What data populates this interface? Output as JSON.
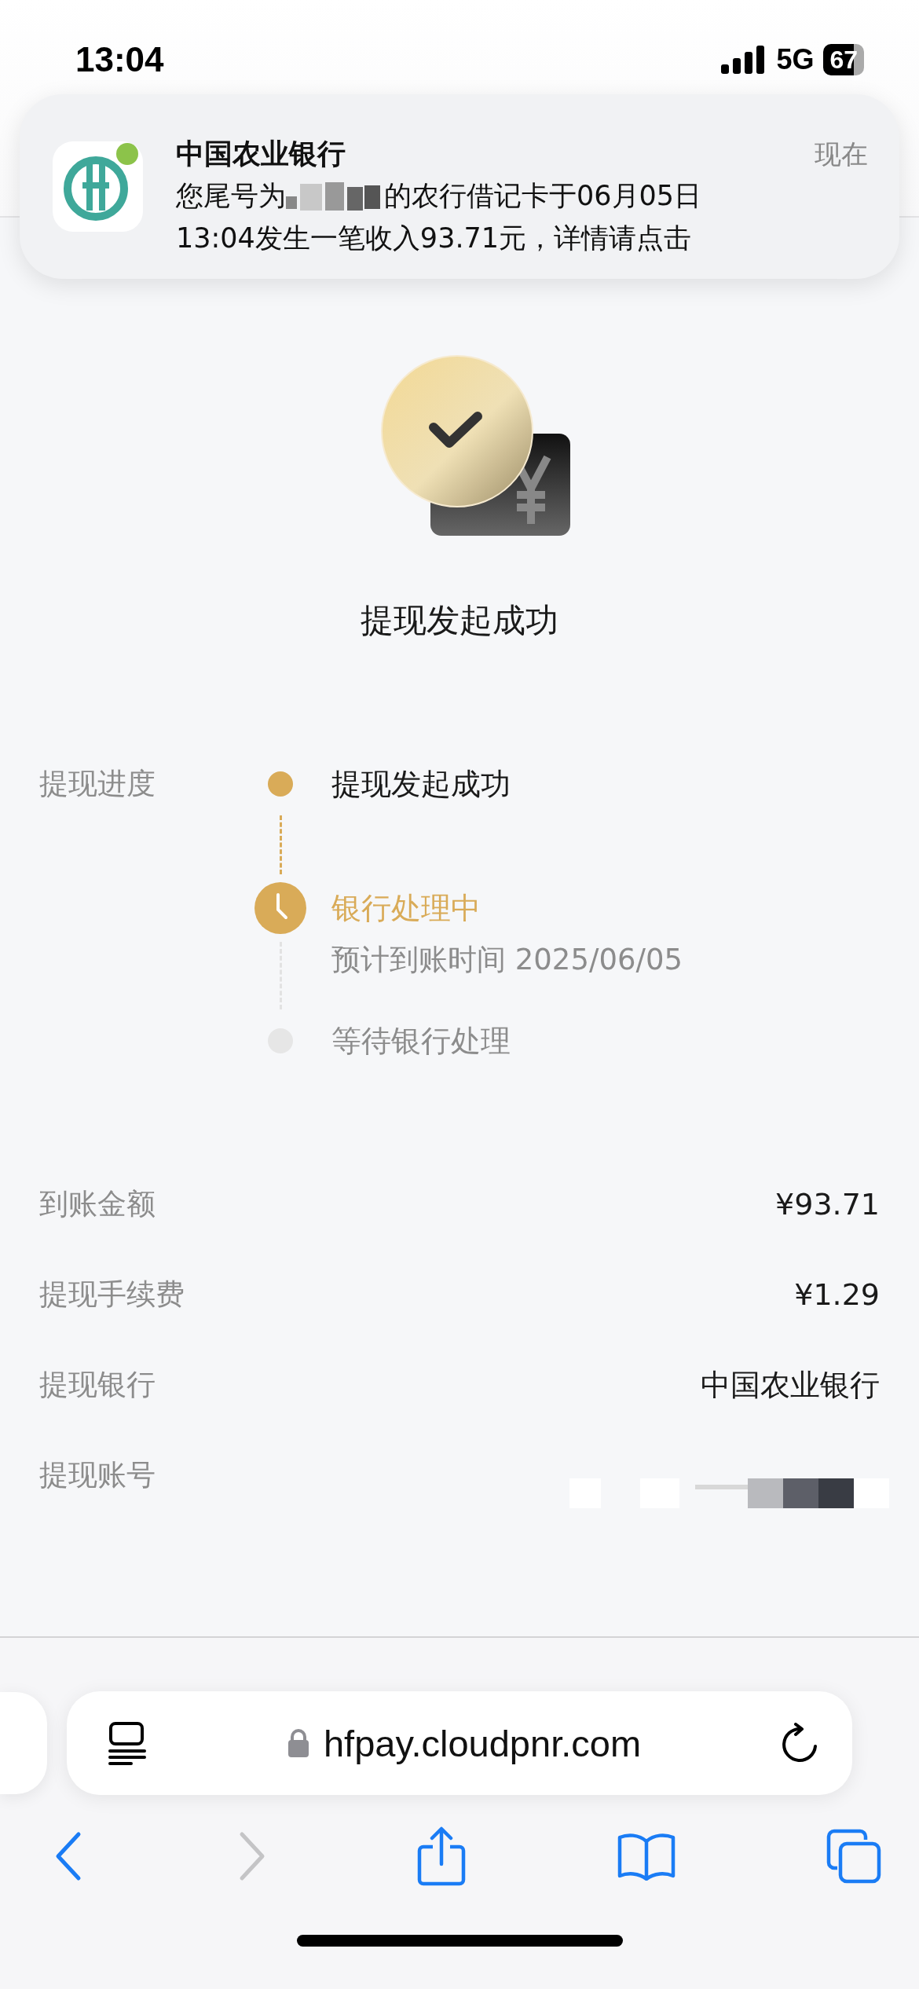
{
  "status_bar": {
    "time": "13:04",
    "network": "5G",
    "battery": "67"
  },
  "notification": {
    "app": "中国农业银行",
    "time": "现在",
    "line1_start": "您尾号为",
    "line1_end": "的农行借记卡于06月05日",
    "line2": "13:04发生一笔收入93.71元，详情请点击"
  },
  "hero": {
    "title": "提现发起成功"
  },
  "progress": {
    "label": "提现进度",
    "steps": [
      {
        "kind": "done",
        "title": "提现发起成功"
      },
      {
        "kind": "current",
        "title": "银行处理中",
        "subtitle": "预计到账时间 2025/06/05"
      },
      {
        "kind": "pending",
        "title": "等待银行处理"
      }
    ]
  },
  "details": [
    {
      "kind": "text",
      "label": "到账金额",
      "value": "¥93.71"
    },
    {
      "kind": "text",
      "label": "提现手续费",
      "value": "¥1.29"
    },
    {
      "kind": "text",
      "label": "提现银行",
      "value": "中国农业银行"
    },
    {
      "kind": "redacted",
      "label": "提现账号"
    }
  ],
  "browser": {
    "url": "hfpay.cloudpnr.com",
    "back_disabled": false,
    "forward_disabled": true
  }
}
